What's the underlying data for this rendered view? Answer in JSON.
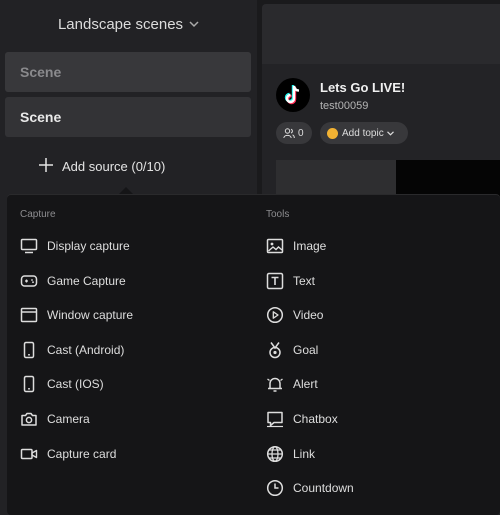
{
  "scenes_panel": {
    "header_title": "Landscape scenes",
    "scenes": [
      "Scene",
      "Scene"
    ],
    "add_source_label": "Add source (0/10)"
  },
  "live": {
    "title": "Lets Go LIVE!",
    "username": "test00059",
    "viewer_count": "0",
    "add_topic_label": "Add topic"
  },
  "source_menu": {
    "capture_title": "Capture",
    "tools_title": "Tools",
    "capture_items": [
      {
        "label": "Display capture",
        "icon": "monitor-icon"
      },
      {
        "label": "Game Capture",
        "icon": "gamepad-icon"
      },
      {
        "label": "Window capture",
        "icon": "window-icon"
      },
      {
        "label": "Cast (Android)",
        "icon": "phone-icon"
      },
      {
        "label": "Cast (IOS)",
        "icon": "phone-icon"
      },
      {
        "label": "Camera",
        "icon": "camera-icon"
      },
      {
        "label": "Capture card",
        "icon": "video-camera-icon"
      }
    ],
    "tools_items": [
      {
        "label": "Image",
        "icon": "image-icon"
      },
      {
        "label": "Text",
        "icon": "text-icon"
      },
      {
        "label": "Video",
        "icon": "play-icon"
      },
      {
        "label": "Goal",
        "icon": "medal-icon"
      },
      {
        "label": "Alert",
        "icon": "bell-icon"
      },
      {
        "label": "Chatbox",
        "icon": "chat-icon"
      },
      {
        "label": "Link",
        "icon": "globe-icon"
      },
      {
        "label": "Countdown",
        "icon": "clock-icon"
      }
    ]
  }
}
